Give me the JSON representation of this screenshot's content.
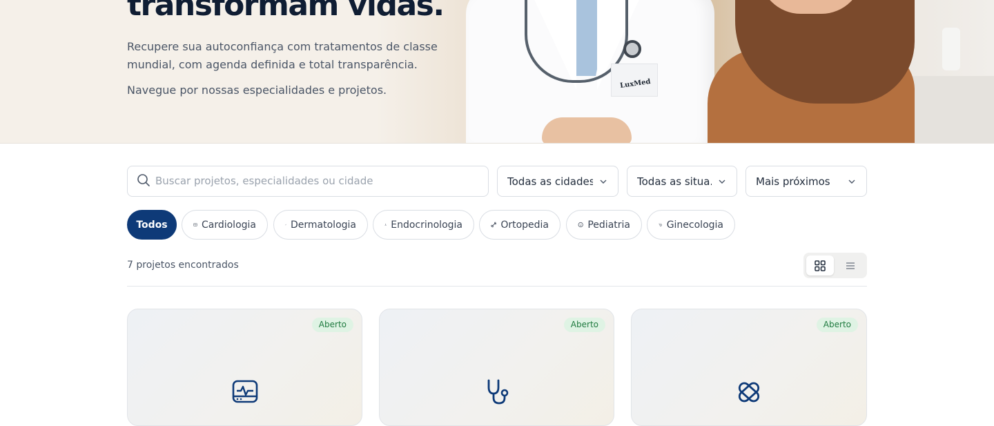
{
  "hero": {
    "title": "transformam vidas.",
    "subtitle": "Recupere sua autoconfiança com tratamentos de classe mundial, com agenda definida e total transparência.",
    "nav_text": "Navegue por nossas especialidades e projetos.",
    "coat_logo": "LuxMed"
  },
  "filters": {
    "search_placeholder": "Buscar projetos, especialidades ou cidade",
    "search_value": "",
    "city": "Todas as cidades",
    "status": "Todas as situa...",
    "sort": "Mais próximos"
  },
  "chips": [
    {
      "label": "Todos",
      "active": true
    },
    {
      "label": "Cardiologia",
      "icon": "monitor-heart-icon"
    },
    {
      "label": "Dermatologia",
      "icon": "bandage-icon"
    },
    {
      "label": "Endocrinologia",
      "icon": "flask-icon"
    },
    {
      "label": "Ortopedia",
      "icon": "bone-icon"
    },
    {
      "label": "Pediatria",
      "icon": "baby-face-icon"
    },
    {
      "label": "Ginecologia",
      "icon": "stethoscope-icon"
    }
  ],
  "results": {
    "count_text": "7 projetos encontrados"
  },
  "view_toggle": {
    "active": "grid"
  },
  "cards": [
    {
      "badge": "Aberto",
      "icon": "monitor-heart-icon"
    },
    {
      "badge": "Aberto",
      "icon": "stethoscope-icon"
    },
    {
      "badge": "Aberto",
      "icon": "bandage-icon"
    }
  ],
  "colors": {
    "primary": "#0e3a78",
    "badge_bg": "#dff3e4",
    "badge_text": "#1f7a3f",
    "hero_bg": "#f5f0e9"
  }
}
